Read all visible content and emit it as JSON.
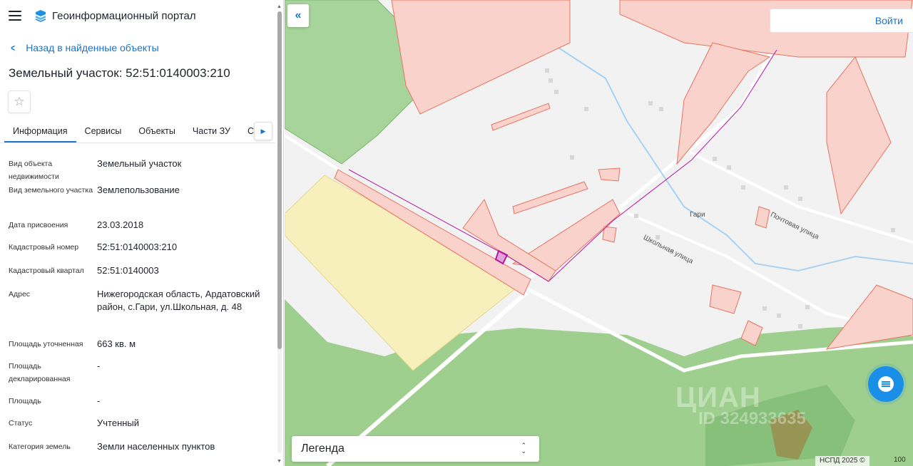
{
  "app": {
    "title": "Геоинформационный портал"
  },
  "nav": {
    "back_label": "Назад в найденные объекты"
  },
  "object": {
    "title": "Земельный участок: 52:51:0140003:210"
  },
  "tabs": [
    {
      "label": "Информация",
      "active": true
    },
    {
      "label": "Сервисы"
    },
    {
      "label": "Объекты"
    },
    {
      "label": "Части ЗУ"
    },
    {
      "label": "Соста"
    }
  ],
  "properties": [
    {
      "key": "Вид объекта недвижимости",
      "value": "Земельный участок"
    },
    {
      "key": "Вид земельного участка",
      "value": "Землепользование"
    },
    {
      "key": "Дата присвоения",
      "value": "23.03.2018"
    },
    {
      "key": "Кадастровый номер",
      "value": "52:51:0140003:210"
    },
    {
      "key": "Кадастровый квартал",
      "value": "52:51:0140003"
    },
    {
      "key": "Адрес",
      "value": "Нижегородская область, Ардатовский район, с.Гари, ул.Школьная, д. 48"
    },
    {
      "key": "Площадь уточненная",
      "value": "663 кв. м"
    },
    {
      "key": "Площадь декларированная",
      "value": "-"
    },
    {
      "key": "Площадь",
      "value": "-"
    },
    {
      "key": "Статус",
      "value": "Учтенный"
    },
    {
      "key": "Категория земель",
      "value": "Земли населенных пунктов"
    }
  ],
  "map": {
    "login_label": "Войти",
    "legend_label": "Легенда",
    "copyright": "НСПД 2025 ©",
    "scale_label": "100",
    "labels": {
      "village": "Гари",
      "street_pochtovaya": "Почтовая улица",
      "street_shkolnaya": "Школьная улица"
    },
    "watermark": {
      "brand": "ЦИАН",
      "id": "ID 324933635"
    }
  },
  "colors": {
    "accent": "#1a73c9",
    "parcel_fill": "#f9d2cc",
    "parcel_stroke": "#e8735f",
    "forest": "#9fcf8f",
    "field": "#f7f0bd",
    "selected": "#b5179e"
  }
}
